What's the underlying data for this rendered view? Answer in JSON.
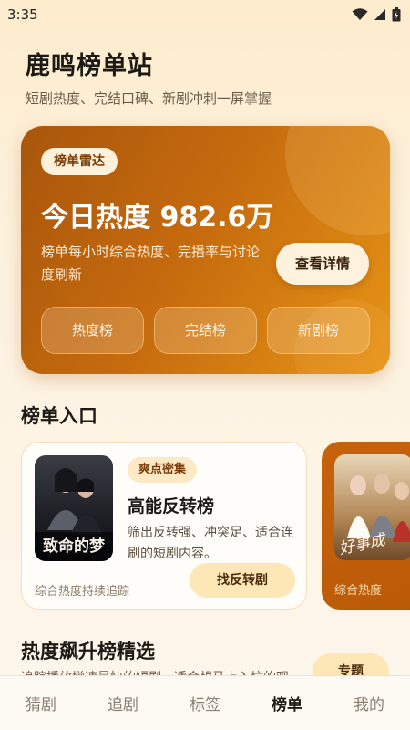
{
  "status_bar": {
    "time": "3:35",
    "icons": [
      "wifi-icon",
      "signal-icon",
      "battery-icon"
    ]
  },
  "header": {
    "title": "鹿鸣榜单站",
    "subtitle": "短剧热度、完结口碑、新剧冲刺一屏掌握"
  },
  "hero": {
    "badge": "榜单雷达",
    "heading": "今日热度 982.6万",
    "description": "榜单每小时综合热度、完播率与讨论度刷新",
    "detail_button": "查看详情",
    "chips": [
      "热度榜",
      "完结榜",
      "新剧榜"
    ],
    "colors": {
      "start": "#a9560c",
      "end": "#e69416"
    }
  },
  "entries_section": {
    "title": "榜单入口",
    "cards": [
      {
        "poster_text": "致命的梦",
        "tag": "爽点密集",
        "title": "高能反转榜",
        "description": "筛出反转强、冲突足、适合连刷的短剧内容。",
        "footer": "综合热度持续追踪",
        "button": "找反转剧"
      },
      {
        "poster_text": "好事成",
        "footer": "综合热度"
      }
    ]
  },
  "rising_section": {
    "title": "热度飙升榜精选",
    "description": "追踪播放增速最快的短剧，适合想马上入坑的观",
    "button": "专题"
  },
  "bottom_nav": {
    "items": [
      "猜剧",
      "追剧",
      "标签",
      "榜单",
      "我的"
    ],
    "active": "榜单"
  },
  "colors": {
    "accent": "#c56a0e",
    "background": "#fdf2df",
    "chip_bg": "#fde7b7"
  }
}
